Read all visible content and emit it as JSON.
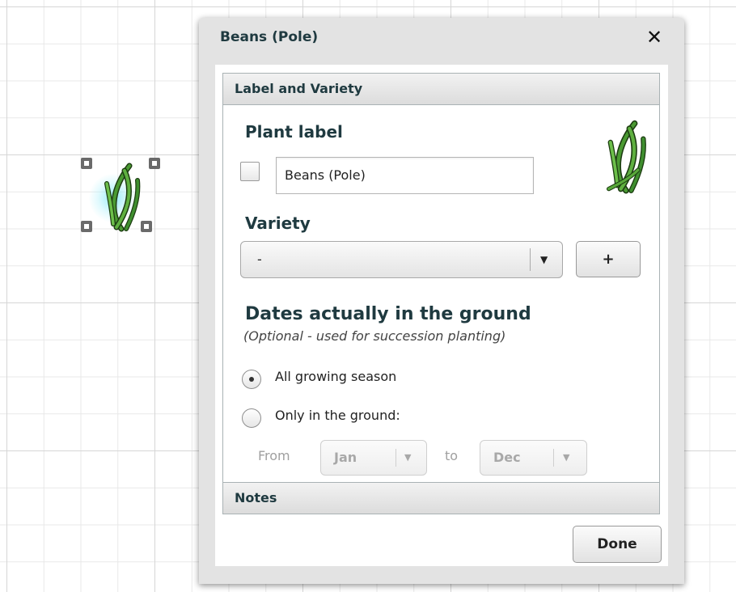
{
  "dialog": {
    "title": "Beans (Pole)",
    "close_icon": "close-icon",
    "sections": {
      "label_and_variety": "Label and Variety",
      "notes": "Notes"
    },
    "plant_label": {
      "heading": "Plant label",
      "input_value": "Beans (Pole)",
      "checkbox_checked": false
    },
    "variety": {
      "heading": "Variety",
      "selected": "-",
      "add_label": "+"
    },
    "dates": {
      "heading": "Dates actually in the ground",
      "subnote": "(Optional - used for succession planting)",
      "option_all": "All growing season",
      "option_only": "Only in the ground:",
      "selected_option": "all",
      "from_label": "From",
      "from_value": "Jan",
      "to_label": "to",
      "to_value": "Dec"
    },
    "done_label": "Done"
  },
  "canvas": {
    "selected_plant_icon": "bean-plant-icon"
  },
  "colors": {
    "heading": "#1f3a40",
    "grid": "#d6d6d6",
    "leaf_green": "#3f8f2f",
    "selection_glow": "#78e6f5"
  }
}
